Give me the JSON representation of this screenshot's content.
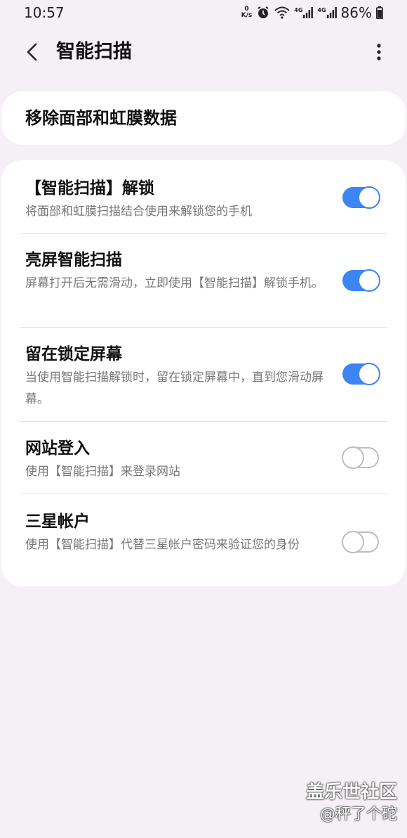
{
  "status_bar": {
    "time": "10:57",
    "net_speed_value": "0",
    "net_speed_unit": "K/s",
    "network_4g_a": "4G",
    "network_4g_b": "4G",
    "battery": "86%"
  },
  "app_bar": {
    "title": "智能扫描"
  },
  "top_card": {
    "label": "移除面部和虹膜数据"
  },
  "settings": [
    {
      "title": "【智能扫描】解锁",
      "desc": "将面部和虹膜扫描结合使用来解锁您的手机",
      "enabled": true
    },
    {
      "title": "亮屏智能扫描",
      "desc": "屏幕打开后无需滑动，立即使用【智能扫描】解锁手机。",
      "enabled": true
    },
    {
      "title": "留在锁定屏幕",
      "desc": "当使用智能扫描解锁时，留在锁定屏幕中，直到您滑动屏幕。",
      "enabled": true
    },
    {
      "title": "网站登入",
      "desc": "使用【智能扫描】来登录网站",
      "enabled": false
    },
    {
      "title": "三星帐户",
      "desc": "使用【智能扫描】代替三星帐户密码来验证您的身份",
      "enabled": false
    }
  ],
  "watermark": {
    "brand": "盖乐世社区",
    "user": "@秤了个砣"
  },
  "colors": {
    "accent": "#3d85f1",
    "background": "#f5f0f5",
    "card": "#ffffff",
    "secondary_text": "#777777"
  }
}
